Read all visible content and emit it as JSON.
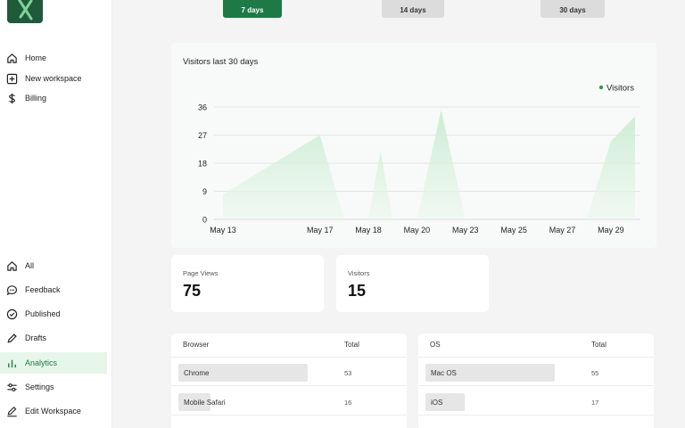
{
  "sidebar": {
    "top_items": [
      {
        "label": "Home",
        "icon": "home-icon"
      },
      {
        "label": "New workspace",
        "icon": "plus-square-icon"
      },
      {
        "label": "Billing",
        "icon": "dollar-icon"
      }
    ],
    "bottom_items": [
      {
        "label": "All",
        "icon": "home-icon"
      },
      {
        "label": "Feedback",
        "icon": "chat-icon"
      },
      {
        "label": "Published",
        "icon": "check-circle-icon"
      },
      {
        "label": "Drafts",
        "icon": "pen-icon"
      },
      {
        "label": "Analytics",
        "icon": "bar-chart-icon",
        "active": true
      },
      {
        "label": "Settings",
        "icon": "sliders-icon"
      },
      {
        "label": "Edit Workspace",
        "icon": "edit-icon"
      }
    ]
  },
  "range": {
    "buttons": [
      {
        "label": "7 days",
        "selected": true
      },
      {
        "label": "14 days",
        "selected": false
      },
      {
        "label": "30 days",
        "selected": false
      }
    ]
  },
  "colors": {
    "accent": "#1d7a47",
    "area_fill": "#d5efd9",
    "legend_dot": "#2e9a5c"
  },
  "chart_data": {
    "type": "area",
    "title": "Visitors last 30 days",
    "legend": "top-right",
    "series": [
      {
        "name": "Visitors",
        "points": [
          [
            13,
            8
          ],
          [
            17,
            27
          ],
          [
            18,
            0
          ],
          [
            19,
            0
          ],
          [
            19.5,
            22
          ],
          [
            20,
            0
          ],
          [
            21,
            0
          ],
          [
            22,
            35
          ],
          [
            23,
            0
          ],
          [
            28,
            0
          ],
          [
            29,
            25
          ],
          [
            30,
            33
          ]
        ]
      }
    ],
    "x_ticks": [
      {
        "label": "May 13",
        "value": 13
      },
      {
        "label": "May 17",
        "value": 17
      },
      {
        "label": "May 18",
        "value": 19
      },
      {
        "label": "May 20",
        "value": 21
      },
      {
        "label": "May 23",
        "value": 23
      },
      {
        "label": "May 25",
        "value": 25
      },
      {
        "label": "May 27",
        "value": 27
      },
      {
        "label": "May 29",
        "value": 29
      }
    ],
    "y_ticks": [
      0,
      9,
      18,
      27,
      36
    ],
    "ylim": [
      0,
      36
    ],
    "grid": true
  },
  "stats": [
    {
      "label": "Page Views",
      "value": "75"
    },
    {
      "label": "Visitors",
      "value": "15"
    }
  ],
  "browser_table": {
    "col1": "Browser",
    "col2": "Total",
    "rows": [
      {
        "name": "Chrome",
        "total": "53",
        "share": 0.98
      },
      {
        "name": "Mobile Safari",
        "total": "16",
        "share": 0.24
      }
    ]
  },
  "os_table": {
    "col1": "OS",
    "col2": "Total",
    "rows": [
      {
        "name": "Mac OS",
        "total": "55",
        "share": 0.98
      },
      {
        "name": "iOS",
        "total": "17",
        "share": 0.3
      }
    ]
  }
}
